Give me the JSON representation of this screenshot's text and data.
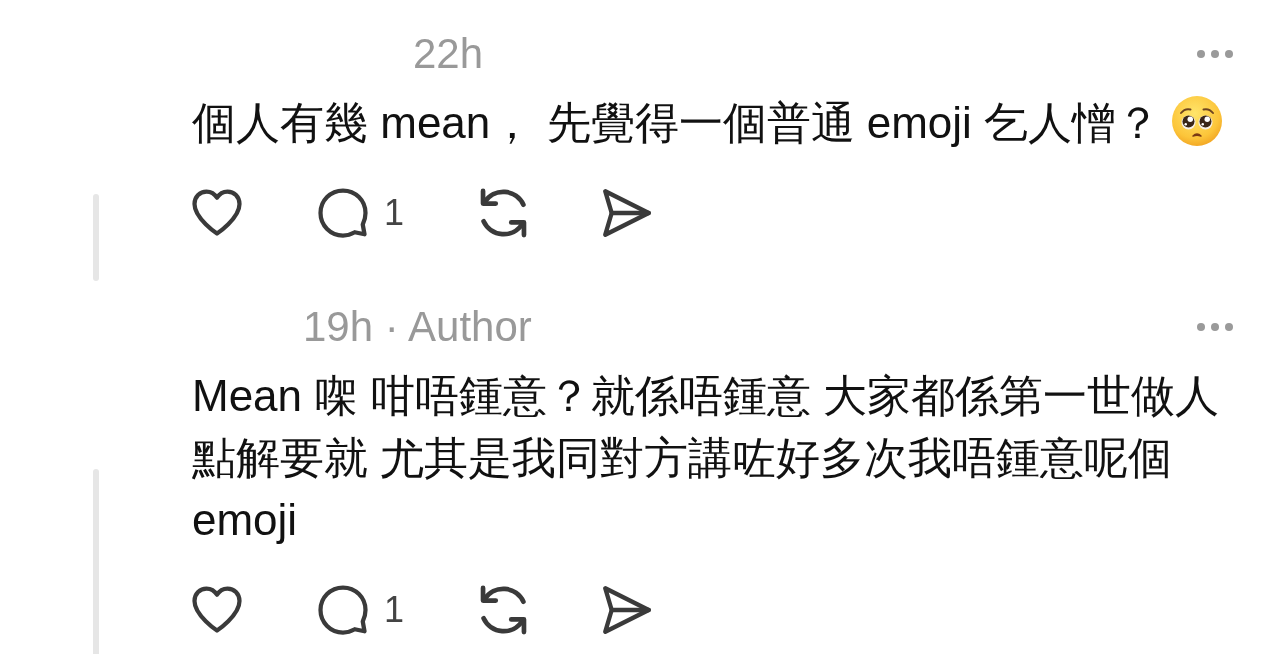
{
  "comments": [
    {
      "meta": "22h",
      "text": "個人有幾 mean， 先覺得一個普通 emoji 乞人憎？",
      "has_emoji": true,
      "actions": [
        {
          "kind": "like"
        },
        {
          "kind": "reply",
          "count": "1"
        },
        {
          "kind": "repost"
        },
        {
          "kind": "share"
        }
      ]
    },
    {
      "meta": "19h · Author",
      "text": "Mean 㗎 咁唔鍾意？就係唔鍾意 大家都係第一世做人點解要就 尤其是我同對方講咗好多次我唔鍾意呢個 emoji",
      "has_emoji": false,
      "actions": [
        {
          "kind": "like"
        },
        {
          "kind": "reply",
          "count": "1"
        },
        {
          "kind": "repost"
        },
        {
          "kind": "share"
        }
      ]
    }
  ]
}
